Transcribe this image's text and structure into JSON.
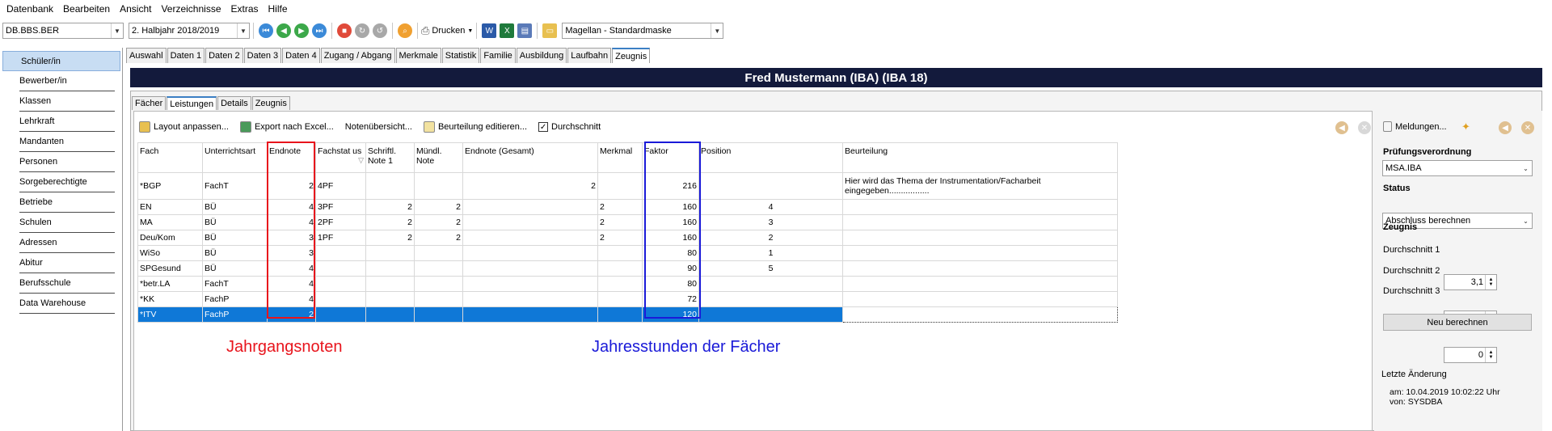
{
  "menu": [
    "Datenbank",
    "Bearbeiten",
    "Ansicht",
    "Verzeichnisse",
    "Extras",
    "Hilfe"
  ],
  "toolbar": {
    "db": "DB.BBS.BER",
    "period": "2. Halbjahr 2018/2019",
    "print": "Drucken",
    "mask": "Magellan - Standardmaske"
  },
  "sidebar": [
    "Schüler/in",
    "Bewerber/in",
    "Klassen",
    "Lehrkraft",
    "Mandanten",
    "Personen",
    "Sorgeberechtigte",
    "Betriebe",
    "Schulen",
    "Adressen",
    "Abitur",
    "Berufsschule",
    "Data Warehouse"
  ],
  "tabs": [
    "Auswahl",
    "Daten 1",
    "Daten 2",
    "Daten 3",
    "Daten 4",
    "Zugang / Abgang",
    "Merkmale",
    "Statistik",
    "Familie",
    "Ausbildung",
    "Laufbahn",
    "Zeugnis"
  ],
  "title": "Fred Mustermann (IBA) (IBA 18)",
  "subtabs": [
    "Fächer",
    "Leistungen",
    "Details",
    "Zeugnis"
  ],
  "actions": {
    "layout": "Layout anpassen...",
    "export": "Export nach Excel...",
    "notes": "Notenübersicht...",
    "edit": "Beurteilung editieren...",
    "avg": "Durchschnitt",
    "messages": "Meldungen..."
  },
  "columns": [
    "Fach",
    "Unterrichtsart",
    "Endnote",
    "Fachstat us",
    "Schriftl. Note 1",
    "Mündl. Note",
    "Endnote (Gesamt)",
    "Merkmal",
    "Faktor",
    "Position",
    "Beurteilung"
  ],
  "rows": [
    [
      "*BGP",
      "FachT",
      "2",
      "4PF",
      "",
      "",
      "2",
      "",
      "216",
      "",
      "Hier wird das Thema der Instrumentation/Facharbeit eingegeben................."
    ],
    [
      "EN",
      "BÜ",
      "4",
      "3PF",
      "2",
      "2",
      "",
      "2",
      "160",
      "4",
      ""
    ],
    [
      "MA",
      "BÜ",
      "4",
      "2PF",
      "2",
      "2",
      "",
      "2",
      "160",
      "3",
      ""
    ],
    [
      "Deu/Kom",
      "BÜ",
      "3",
      "1PF",
      "2",
      "2",
      "",
      "2",
      "160",
      "2",
      ""
    ],
    [
      "WiSo",
      "BÜ",
      "3",
      "",
      "",
      "",
      "",
      "",
      "80",
      "1",
      ""
    ],
    [
      "SPGesund",
      "BÜ",
      "4",
      "",
      "",
      "",
      "",
      "",
      "90",
      "5",
      ""
    ],
    [
      "*betr.LA",
      "FachT",
      "4",
      "",
      "",
      "",
      "",
      "",
      "80",
      "",
      ""
    ],
    [
      "*KK",
      "FachP",
      "4",
      "",
      "",
      "",
      "",
      "",
      "72",
      "",
      ""
    ],
    [
      "*ITV",
      "FachP",
      "2",
      "",
      "",
      "",
      "",
      "",
      "120",
      "",
      ""
    ]
  ],
  "annotations": {
    "grades": "Jahrgangsnoten",
    "hours": "Jahresstunden der Fächer"
  },
  "right": {
    "exam_label": "Prüfungsverordnung",
    "exam_value": "MSA.IBA",
    "status_label": "Status",
    "status_value": "Abschluss berechnen",
    "report_label": "Zeugnis",
    "avg1_label": "Durchschnitt 1",
    "avg1": "3,1",
    "avg2_label": "Durchschnitt 2",
    "avg2": "0",
    "avg3_label": "Durchschnitt 3",
    "avg3": "0",
    "recalc": "Neu berechnen",
    "last_change": "Letzte Änderung",
    "am": "am:  10.04.2019 10:02:22 Uhr",
    "von": "von:  SYSDBA"
  },
  "colors": {
    "selection": "#0f78d7",
    "title_bg": "#131a3c",
    "red": "#e8141c",
    "blue": "#1a1ad8"
  }
}
